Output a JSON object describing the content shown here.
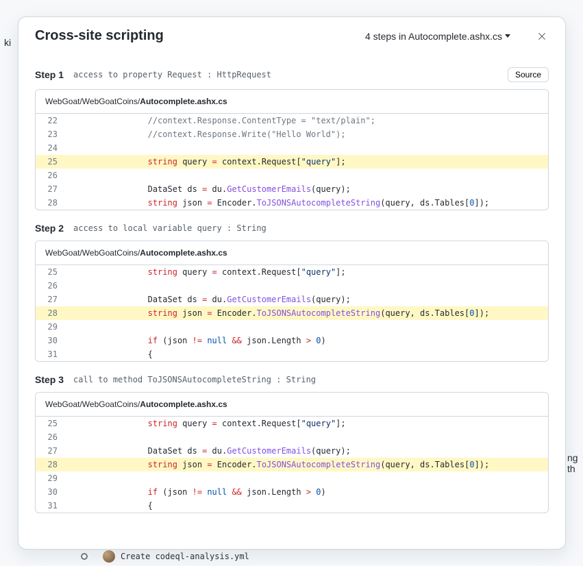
{
  "backdrop": {
    "ki": "ki",
    "ng_th": "ng th",
    "commit_msg": "Create codeql-analysis.yml"
  },
  "dialog": {
    "title": "Cross-site scripting",
    "steps_summary": "4 steps in Autocomplete.ashx.cs",
    "source_btn": "Source"
  },
  "path_prefix": "WebGoat/WebGoatCoins/",
  "path_file": "Autocomplete.ashx.cs",
  "steps": [
    {
      "label": "Step 1",
      "desc": "access to property Request : HttpRequest",
      "show_source_btn": true,
      "lines": [
        {
          "n": 22,
          "hl": false,
          "tokens": [
            [
              "                ",
              "id"
            ],
            [
              "//context.Response.ContentType = \"text/plain\";",
              "c"
            ]
          ]
        },
        {
          "n": 23,
          "hl": false,
          "tokens": [
            [
              "                ",
              "id"
            ],
            [
              "//context.Response.Write(\"Hello World\");",
              "c"
            ]
          ]
        },
        {
          "n": 24,
          "hl": false,
          "tokens": []
        },
        {
          "n": 25,
          "hl": true,
          "tokens": [
            [
              "                ",
              "id"
            ],
            [
              "string",
              "k"
            ],
            [
              " ",
              "id"
            ],
            [
              "query",
              "id"
            ],
            [
              " ",
              "id"
            ],
            [
              "=",
              "k2"
            ],
            [
              " ",
              "id"
            ],
            [
              "context",
              "sel"
            ],
            [
              ".",
              "sel"
            ],
            [
              "Request",
              "sel"
            ],
            [
              "[",
              "id"
            ],
            [
              "\"query\"",
              "s"
            ],
            [
              "];",
              "id"
            ]
          ]
        },
        {
          "n": 26,
          "hl": false,
          "tokens": []
        },
        {
          "n": 27,
          "hl": false,
          "tokens": [
            [
              "                ",
              "id"
            ],
            [
              "DataSet",
              "id"
            ],
            [
              " ds ",
              "id"
            ],
            [
              "=",
              "k2"
            ],
            [
              " du.",
              "id"
            ],
            [
              "GetCustomerEmails",
              "fn"
            ],
            [
              "(query);",
              "id"
            ]
          ]
        },
        {
          "n": 28,
          "hl": false,
          "tokens": [
            [
              "                ",
              "id"
            ],
            [
              "string",
              "k"
            ],
            [
              " json ",
              "id"
            ],
            [
              "=",
              "k2"
            ],
            [
              " Encoder.",
              "id"
            ],
            [
              "ToJSONSAutocompleteString",
              "fn"
            ],
            [
              "(query, ds.Tables[",
              "id"
            ],
            [
              "0",
              "n"
            ],
            [
              "]);",
              "id"
            ]
          ]
        }
      ]
    },
    {
      "label": "Step 2",
      "desc": "access to local variable query : String",
      "show_source_btn": false,
      "lines": [
        {
          "n": 25,
          "hl": false,
          "tokens": [
            [
              "                ",
              "id"
            ],
            [
              "string",
              "k"
            ],
            [
              " query ",
              "id"
            ],
            [
              "=",
              "k2"
            ],
            [
              " context.Request[",
              "id"
            ],
            [
              "\"query\"",
              "s"
            ],
            [
              "];",
              "id"
            ]
          ]
        },
        {
          "n": 26,
          "hl": false,
          "tokens": []
        },
        {
          "n": 27,
          "hl": false,
          "tokens": [
            [
              "                ",
              "id"
            ],
            [
              "DataSet",
              "id"
            ],
            [
              " ds ",
              "id"
            ],
            [
              "=",
              "k2"
            ],
            [
              " du.",
              "id"
            ],
            [
              "GetCustomerEmails",
              "fn"
            ],
            [
              "(query);",
              "id"
            ]
          ]
        },
        {
          "n": 28,
          "hl": true,
          "tokens": [
            [
              "                ",
              "id"
            ],
            [
              "string",
              "k"
            ],
            [
              " json ",
              "id"
            ],
            [
              "=",
              "k2"
            ],
            [
              " Encoder.",
              "id"
            ],
            [
              "ToJSONSAutocompleteString",
              "fn"
            ],
            [
              "(",
              "id"
            ],
            [
              "query",
              "sel"
            ],
            [
              ", ds.Tables[",
              "id"
            ],
            [
              "0",
              "n"
            ],
            [
              "]);",
              "id"
            ]
          ]
        },
        {
          "n": 29,
          "hl": false,
          "tokens": []
        },
        {
          "n": 30,
          "hl": false,
          "tokens": [
            [
              "                ",
              "id"
            ],
            [
              "if",
              "k"
            ],
            [
              " (json ",
              "id"
            ],
            [
              "!=",
              "k2"
            ],
            [
              " ",
              "id"
            ],
            [
              "null",
              "n"
            ],
            [
              " ",
              "id"
            ],
            [
              "&&",
              "k2"
            ],
            [
              " json.Length ",
              "id"
            ],
            [
              ">",
              "k2"
            ],
            [
              " ",
              "id"
            ],
            [
              "0",
              "n"
            ],
            [
              ")",
              "id"
            ]
          ]
        },
        {
          "n": 31,
          "hl": false,
          "tokens": [
            [
              "                {",
              "id"
            ]
          ]
        }
      ]
    },
    {
      "label": "Step 3",
      "desc": "call to method ToJSONSAutocompleteString : String",
      "show_source_btn": false,
      "lines": [
        {
          "n": 25,
          "hl": false,
          "tokens": [
            [
              "                ",
              "id"
            ],
            [
              "string",
              "k"
            ],
            [
              " query ",
              "id"
            ],
            [
              "=",
              "k2"
            ],
            [
              " context.Request[",
              "id"
            ],
            [
              "\"query\"",
              "s"
            ],
            [
              "];",
              "id"
            ]
          ]
        },
        {
          "n": 26,
          "hl": false,
          "tokens": []
        },
        {
          "n": 27,
          "hl": false,
          "tokens": [
            [
              "                ",
              "id"
            ],
            [
              "DataSet",
              "id"
            ],
            [
              " ds ",
              "id"
            ],
            [
              "=",
              "k2"
            ],
            [
              " du.",
              "id"
            ],
            [
              "GetCustomerEmails",
              "fn"
            ],
            [
              "(query);",
              "id"
            ]
          ]
        },
        {
          "n": 28,
          "hl": true,
          "tokens": [
            [
              "                ",
              "id"
            ],
            [
              "string",
              "k"
            ],
            [
              " json ",
              "id"
            ],
            [
              "=",
              "k2"
            ],
            [
              " ",
              "id"
            ],
            [
              "Encoder",
              "sel"
            ],
            [
              ".",
              "sel"
            ],
            [
              "ToJSONSAutocompleteString",
              "selFn"
            ],
            [
              "(",
              "sel"
            ],
            [
              "query",
              "sel"
            ],
            [
              ",",
              "sel"
            ],
            [
              " ",
              "sel"
            ],
            [
              "ds",
              "sel"
            ],
            [
              ".",
              "sel"
            ],
            [
              "Tables",
              "sel"
            ],
            [
              "[",
              "sel"
            ],
            [
              "0",
              "selN"
            ],
            [
              "]",
              "sel"
            ],
            [
              ")",
              "sel"
            ],
            [
              ";",
              "id"
            ]
          ]
        },
        {
          "n": 29,
          "hl": false,
          "tokens": []
        },
        {
          "n": 30,
          "hl": false,
          "tokens": [
            [
              "                ",
              "id"
            ],
            [
              "if",
              "k"
            ],
            [
              " (json ",
              "id"
            ],
            [
              "!=",
              "k2"
            ],
            [
              " ",
              "id"
            ],
            [
              "null",
              "n"
            ],
            [
              " ",
              "id"
            ],
            [
              "&&",
              "k2"
            ],
            [
              " json.Length ",
              "id"
            ],
            [
              ">",
              "k2"
            ],
            [
              " ",
              "id"
            ],
            [
              "0",
              "n"
            ],
            [
              ")",
              "id"
            ]
          ]
        },
        {
          "n": 31,
          "hl": false,
          "tokens": [
            [
              "                {",
              "id"
            ]
          ]
        }
      ]
    }
  ]
}
